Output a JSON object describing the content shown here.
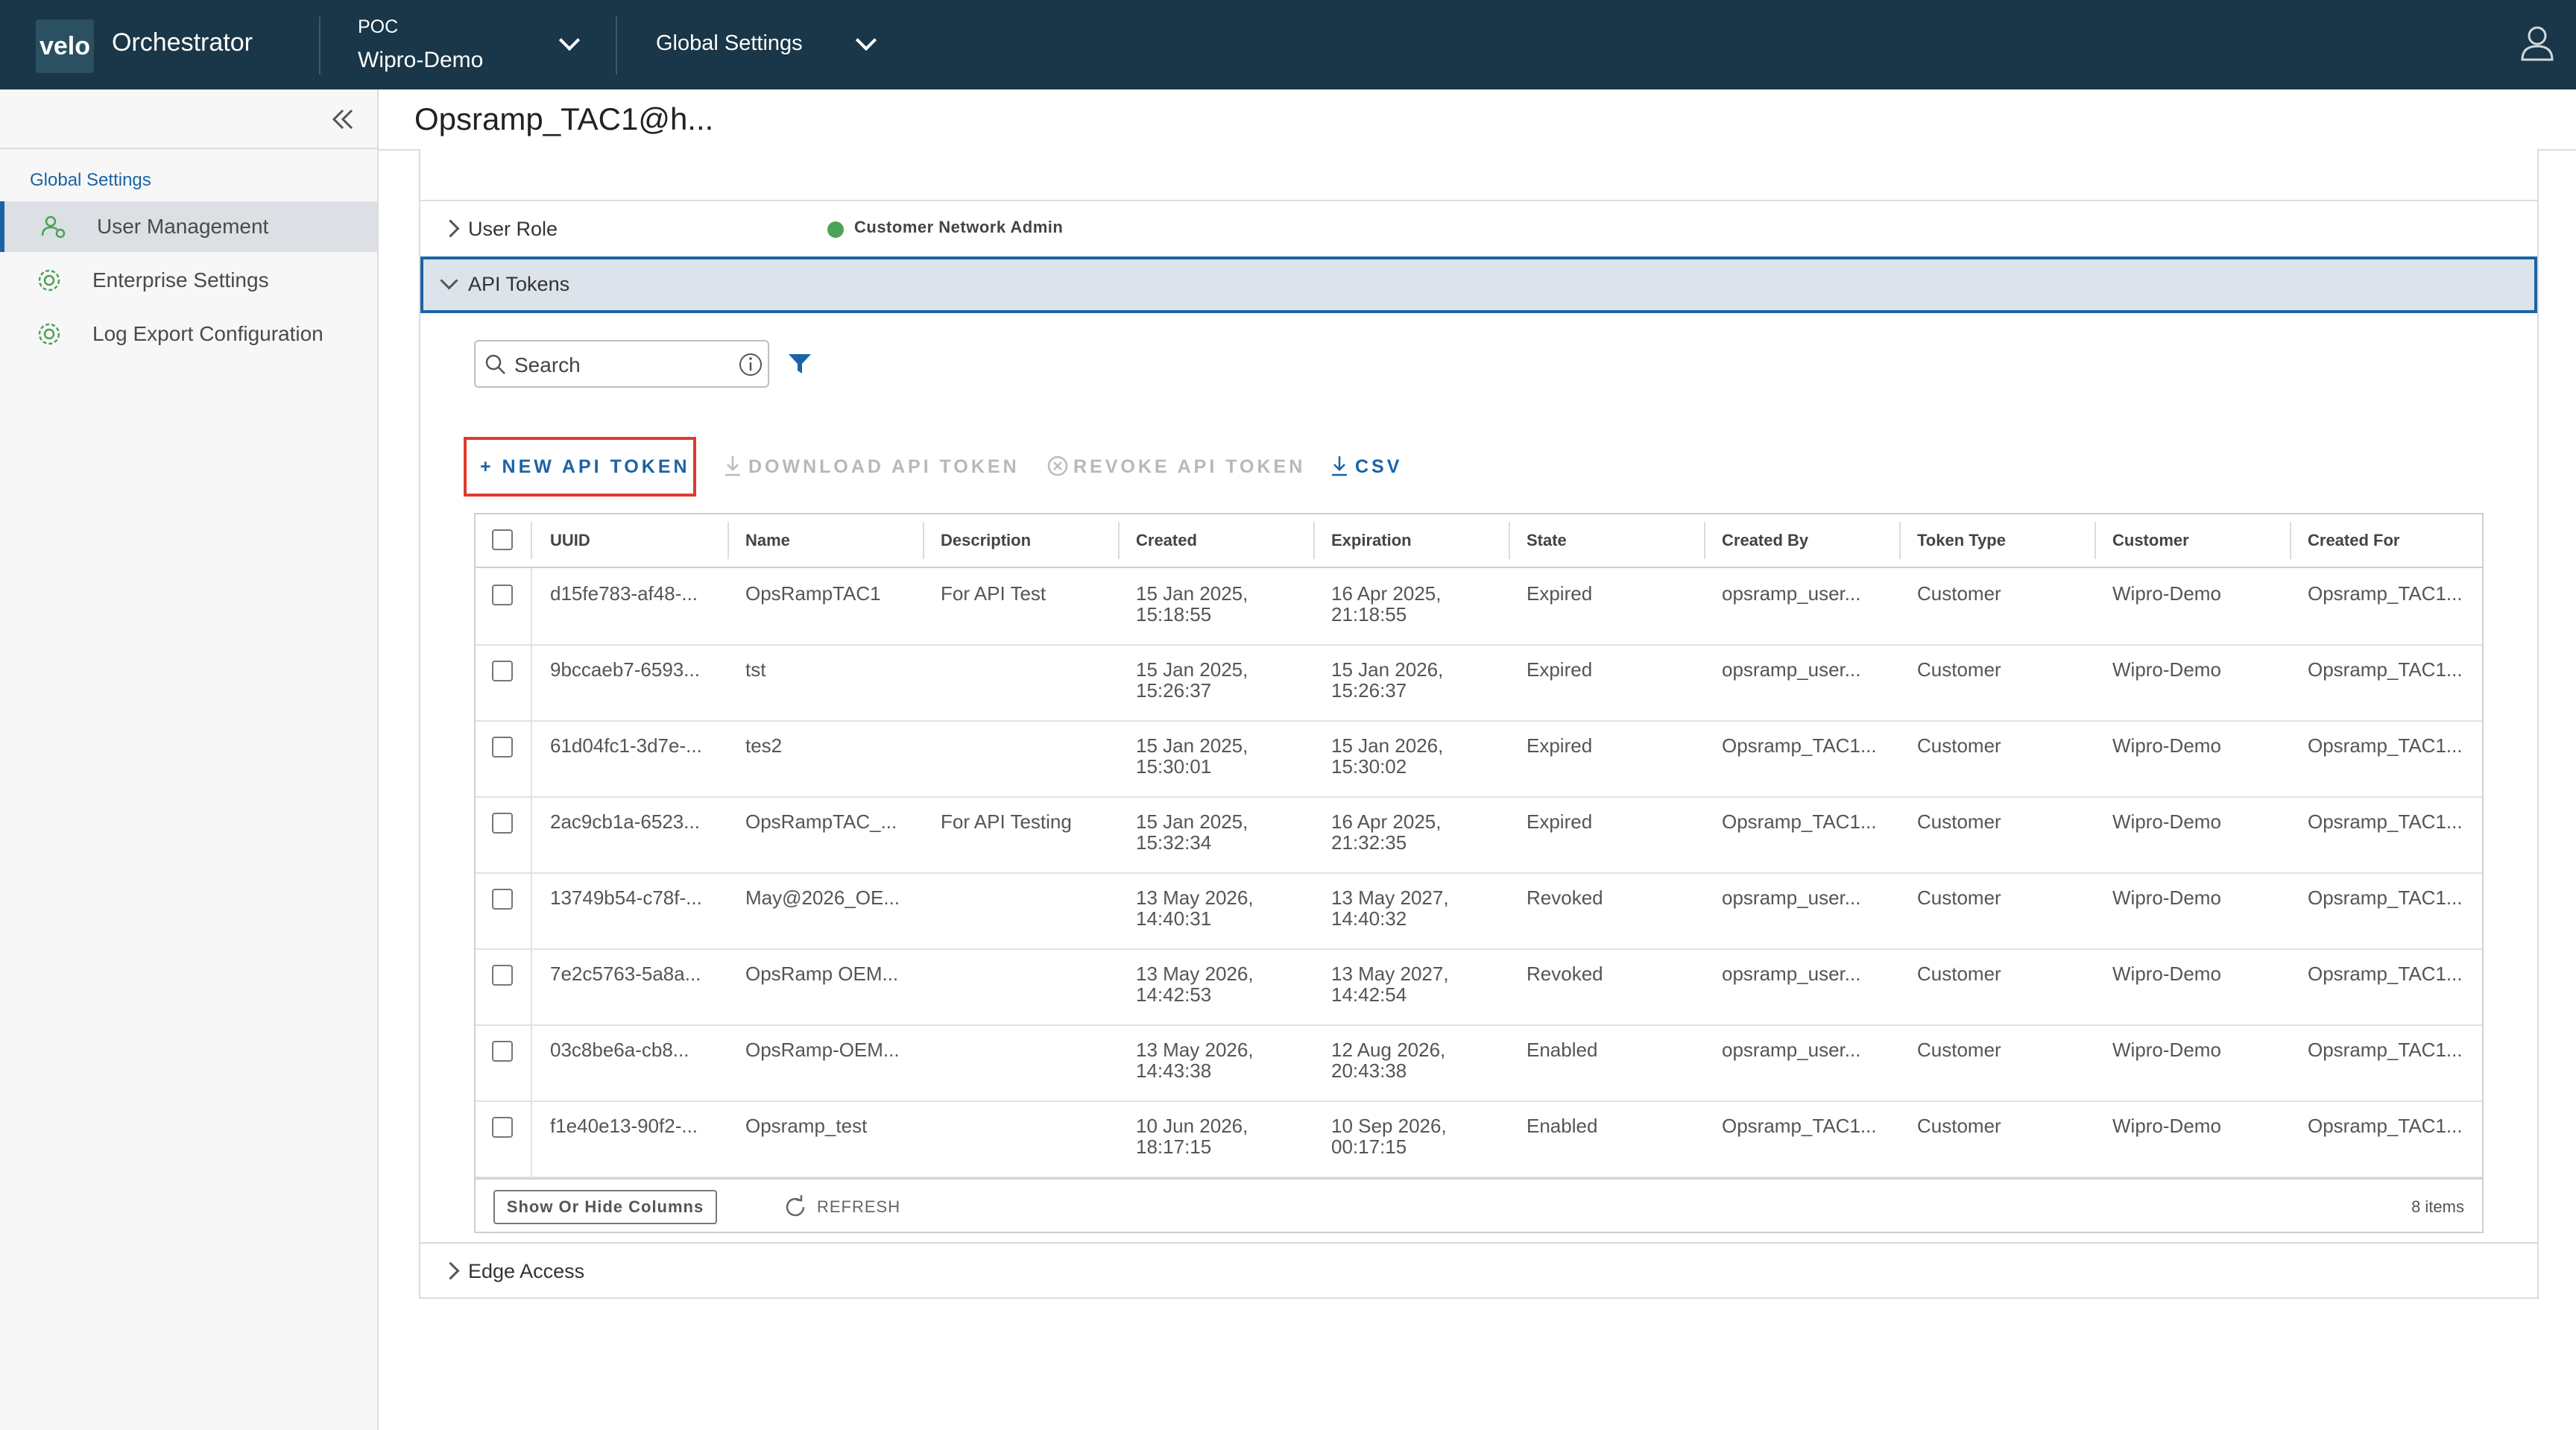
{
  "header": {
    "logo": "velo",
    "app_title": "Orchestrator",
    "poc_label": "POC",
    "org_name": "Wipro-Demo",
    "global_settings": "Global Settings"
  },
  "sidebar": {
    "section_title": "Global Settings",
    "items": [
      {
        "label": "User Management"
      },
      {
        "label": "Enterprise Settings"
      },
      {
        "label": "Log Export Configuration"
      }
    ]
  },
  "page_title": "Opsramp_TAC1@h...",
  "sections": {
    "user_role": "User Role",
    "role_value": "Customer Network Admin",
    "api_tokens": "API Tokens",
    "edge_access": "Edge Access"
  },
  "search": {
    "placeholder": "Search"
  },
  "actions": {
    "new_token": "+ NEW API TOKEN",
    "download": "DOWNLOAD API TOKEN",
    "revoke": "REVOKE API TOKEN",
    "csv": "CSV"
  },
  "table": {
    "columns": [
      "UUID",
      "Name",
      "Description",
      "Created",
      "Expiration",
      "State",
      "Created By",
      "Token Type",
      "Customer",
      "Created For"
    ],
    "rows": [
      {
        "uuid": "d15fe783-af48-...",
        "name": "OpsRampTAC1",
        "description": "For API Test",
        "created1": "15 Jan 2025,",
        "created2": "15:18:55",
        "exp1": "16 Apr 2025,",
        "exp2": "21:18:55",
        "state": "Expired",
        "created_by": "opsramp_user...",
        "token_type": "Customer",
        "customer": "Wipro-Demo",
        "created_for": "Opsramp_TAC1..."
      },
      {
        "uuid": "9bccaeb7-6593...",
        "name": "tst",
        "description": "",
        "created1": "15 Jan 2025,",
        "created2": "15:26:37",
        "exp1": "15 Jan 2026,",
        "exp2": "15:26:37",
        "state": "Expired",
        "created_by": "opsramp_user...",
        "token_type": "Customer",
        "customer": "Wipro-Demo",
        "created_for": "Opsramp_TAC1..."
      },
      {
        "uuid": "61d04fc1-3d7e-...",
        "name": "tes2",
        "description": "",
        "created1": "15 Jan 2025,",
        "created2": "15:30:01",
        "exp1": "15 Jan 2026,",
        "exp2": "15:30:02",
        "state": "Expired",
        "created_by": "Opsramp_TAC1...",
        "token_type": "Customer",
        "customer": "Wipro-Demo",
        "created_for": "Opsramp_TAC1..."
      },
      {
        "uuid": "2ac9cb1a-6523...",
        "name": "OpsRampTAC_...",
        "description": "For API Testing",
        "created1": "15 Jan 2025,",
        "created2": "15:32:34",
        "exp1": "16 Apr 2025,",
        "exp2": "21:32:35",
        "state": "Expired",
        "created_by": "Opsramp_TAC1...",
        "token_type": "Customer",
        "customer": "Wipro-Demo",
        "created_for": "Opsramp_TAC1..."
      },
      {
        "uuid": "13749b54-c78f-...",
        "name": "May@2026_OE...",
        "description": "",
        "created1": "13 May 2026,",
        "created2": "14:40:31",
        "exp1": "13 May 2027,",
        "exp2": "14:40:32",
        "state": "Revoked",
        "created_by": "opsramp_user...",
        "token_type": "Customer",
        "customer": "Wipro-Demo",
        "created_for": "Opsramp_TAC1..."
      },
      {
        "uuid": "7e2c5763-5a8a...",
        "name": "OpsRamp OEM...",
        "description": "",
        "created1": "13 May 2026,",
        "created2": "14:42:53",
        "exp1": "13 May 2027,",
        "exp2": "14:42:54",
        "state": "Revoked",
        "created_by": "opsramp_user...",
        "token_type": "Customer",
        "customer": "Wipro-Demo",
        "created_for": "Opsramp_TAC1..."
      },
      {
        "uuid": "03c8be6a-cb8...",
        "name": "OpsRamp-OEM...",
        "description": "",
        "created1": "13 May 2026,",
        "created2": "14:43:38",
        "exp1": "12 Aug 2026,",
        "exp2": "20:43:38",
        "state": "Enabled",
        "created_by": "opsramp_user...",
        "token_type": "Customer",
        "customer": "Wipro-Demo",
        "created_for": "Opsramp_TAC1..."
      },
      {
        "uuid": "f1e40e13-90f2-...",
        "name": "Opsramp_test",
        "description": "",
        "created1": "10 Jun 2026,",
        "created2": "18:17:15",
        "exp1": "10 Sep 2026,",
        "exp2": "00:17:15",
        "state": "Enabled",
        "created_by": "Opsramp_TAC1...",
        "token_type": "Customer",
        "customer": "Wipro-Demo",
        "created_for": "Opsramp_TAC1..."
      }
    ],
    "footer": {
      "show_hide": "Show Or Hide Columns",
      "refresh": "REFRESH",
      "items": "8 items"
    }
  },
  "colors": {
    "header_bg": "#193748",
    "accent": "#1b63a6",
    "highlight_border": "#e23a2e",
    "success": "#4aa356"
  }
}
